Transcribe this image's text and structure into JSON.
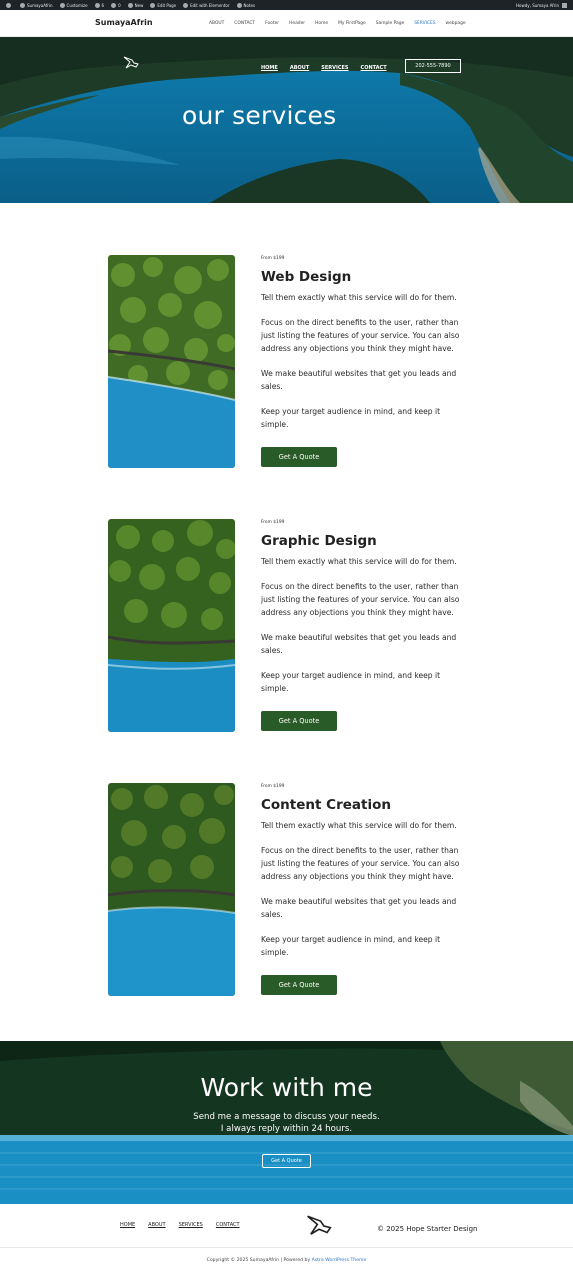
{
  "admin_bar": {
    "items": [
      "SumayaAfrin",
      "Customize",
      "6",
      "0",
      "New",
      "Edit Page",
      "Edit with Elementor",
      "Notes"
    ],
    "greeting": "Howdy, Sumaya Afrin"
  },
  "header": {
    "site_title": "SumayaAfrin",
    "nav": [
      "ABOUT",
      "CONTACT",
      "Footer",
      "Header",
      "Home",
      "My FirstPage",
      "Sample Page",
      "SERVICES",
      "webpage"
    ],
    "active_nav": "SERVICES"
  },
  "hero": {
    "nav": [
      "HOME",
      "ABOUT",
      "SERVICES",
      "CONTACT"
    ],
    "phone": "202-555-7890",
    "title": "our services"
  },
  "services": [
    {
      "price": "From $199",
      "title": "Web Design",
      "paragraphs": [
        "Tell them exactly what this service will do for them.",
        "Focus on the direct benefits to the user, rather than just listing the features of your service. You can also address any objections you think they might have.",
        "We make beautiful websites that get you leads and sales.",
        "Keep your target audience in mind, and keep it simple."
      ],
      "button": "Get A Quote"
    },
    {
      "price": "From $199",
      "title": "Graphic Design",
      "paragraphs": [
        "Tell them exactly what this service will do for them.",
        "Focus on the direct benefits to the user, rather than just listing the features of your service. You can also address any objections you think they might have.",
        "We make beautiful websites that get you leads and sales.",
        "Keep your target audience in mind, and keep it simple."
      ],
      "button": "Get A Quote"
    },
    {
      "price": "From $199",
      "title": "Content Creation",
      "paragraphs": [
        "Tell them exactly what this service will do for them.",
        "Focus on the direct benefits to the user, rather than just listing the features of your service. You can also address any objections you think they might have.",
        "We make beautiful websites that get you leads and sales.",
        "Keep your target audience in mind, and keep it simple."
      ],
      "button": "Get A Quote"
    }
  ],
  "work": {
    "title": "Work with me",
    "line1": "Send me a message to discuss your needs.",
    "line2": "I always reply within 24 hours.",
    "button": "Get A Quote"
  },
  "footer": {
    "nav": [
      "HOME",
      "ABOUT",
      "SERVICES",
      "CONTACT"
    ],
    "copyright": "© 2025 Hope Starter Design"
  },
  "bottom_bar": {
    "text": "Copyright © 2025 SumayaAfrin | Powered by",
    "link": "Astra WordPress Theme"
  },
  "colors": {
    "admin_bar": "#1d2327",
    "button_green": "#285b27",
    "lake_blue": "#0c6f9e",
    "link_blue": "#2c77c9"
  },
  "icons": [
    "wordpress-icon",
    "bird-logo-icon"
  ]
}
